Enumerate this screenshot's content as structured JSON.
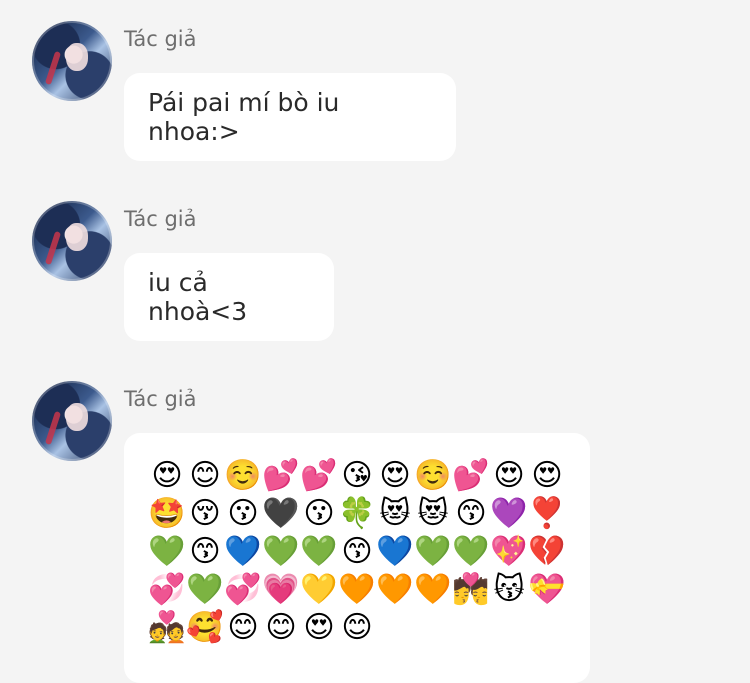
{
  "messages": [
    {
      "author": "Tác giả",
      "text": "Pái pai mí bò iu nhoa:>"
    },
    {
      "author": "Tác giả",
      "text": "iu cả nhoà<3"
    },
    {
      "author": "Tác giả",
      "emojis": [
        "😍",
        "😊",
        "☺️",
        "💕",
        "💕",
        "😘",
        "😍",
        "☺️",
        "💕",
        "😍",
        "😍",
        "🤩",
        "😚",
        "😗",
        "🖤",
        "😗",
        "🍀",
        "😻",
        "😻",
        "😙",
        "💜",
        "❣️",
        "💚",
        "😙",
        "💙",
        "💚",
        "💚",
        "😙",
        "💙",
        "💚",
        "💚",
        "💖",
        "💔",
        "💞",
        "💚",
        "💞",
        "💗",
        "💛",
        "🧡",
        "🧡",
        "🧡",
        "💏",
        "😽",
        "💝",
        "💑",
        "🥰",
        "😊",
        "😊",
        "😍",
        "😊"
      ]
    }
  ]
}
